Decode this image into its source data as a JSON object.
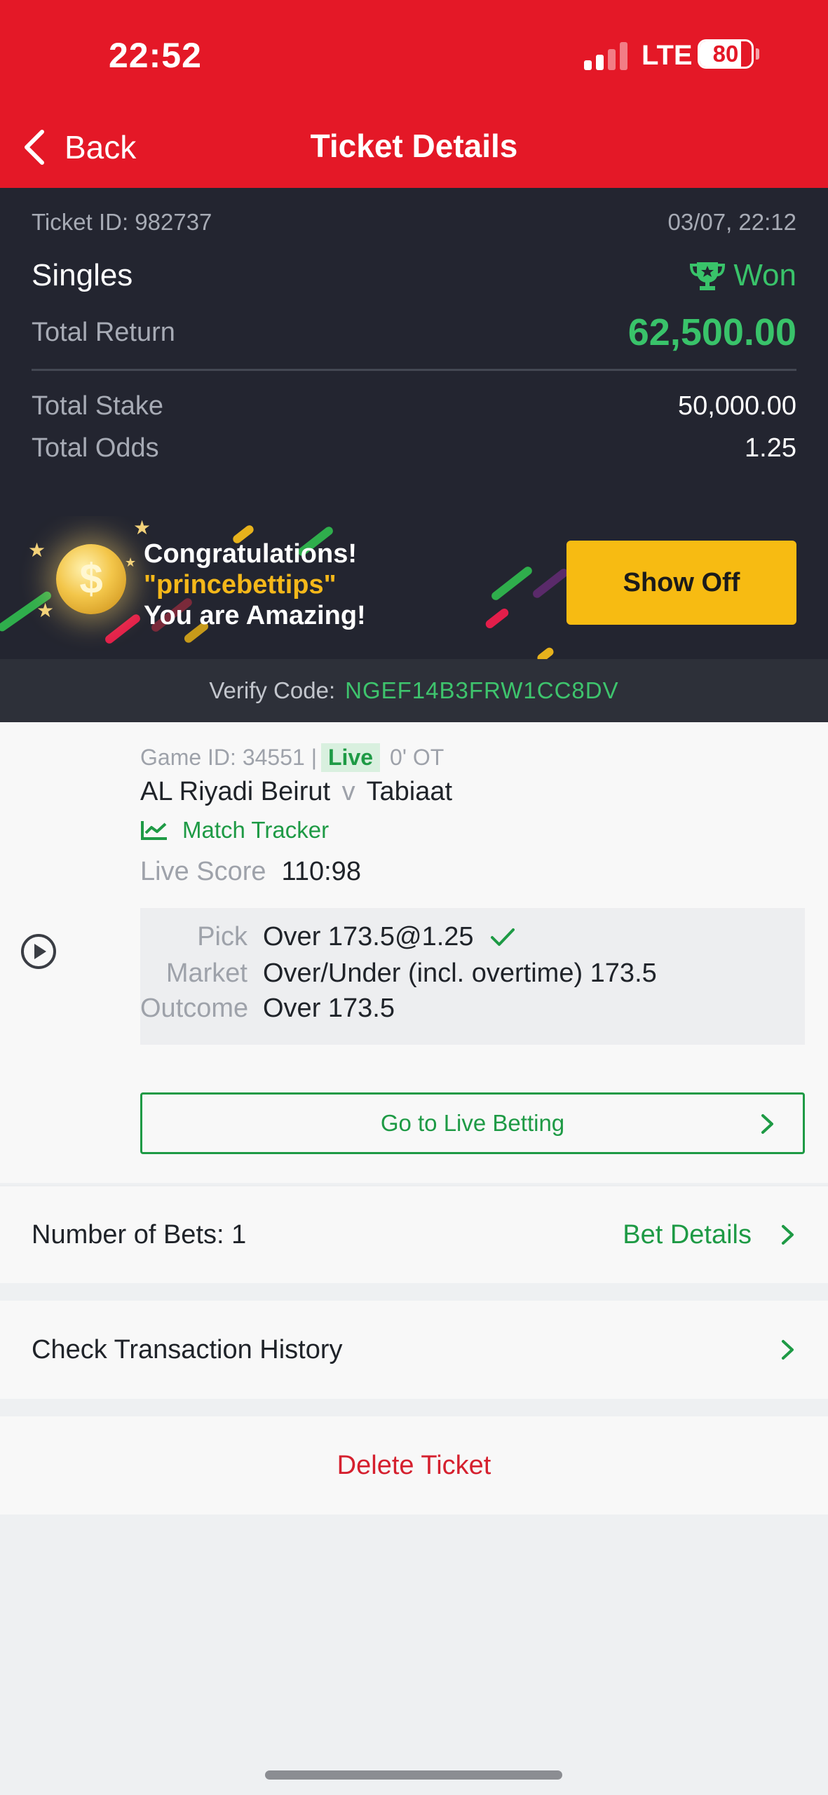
{
  "status_bar": {
    "time": "22:52",
    "network": "LTE",
    "battery_percent": "80",
    "battery_level": 0.8
  },
  "header": {
    "back_label": "Back",
    "title": "Ticket Details"
  },
  "summary": {
    "ticket_id": "Ticket ID: 982737",
    "datetime": "03/07, 22:12",
    "bet_type": "Singles",
    "status": "Won",
    "total_return_label": "Total Return",
    "total_return": "62,500.00",
    "total_stake_label": "Total Stake",
    "total_stake": "50,000.00",
    "total_odds_label": "Total Odds",
    "total_odds": "1.25"
  },
  "banner": {
    "line1": "Congratulations!",
    "line2": "\"princebettips\"",
    "line3": "You are Amazing!",
    "coin_symbol": "$",
    "show_off_label": "Show Off"
  },
  "verify": {
    "label": "Verify Code:",
    "code": "NGEF14B3FRW1CC8DV"
  },
  "bet": {
    "game_id": "Game ID: 34551 |",
    "live_badge": "Live",
    "clock": "0' OT",
    "home_team": "AL Riyadi Beirut",
    "vs": "v",
    "away_team": "Tabiaat",
    "tracker_label": "Match Tracker",
    "live_score_label": "Live Score",
    "live_score": "110:98",
    "pick_label": "Pick",
    "pick": "Over 173.5@1.25",
    "market_label": "Market",
    "market": "Over/Under (incl. overtime) 173.5",
    "outcome_label": "Outcome",
    "outcome": "Over 173.5",
    "live_betting_label": "Go to Live Betting"
  },
  "rows": {
    "number_of_bets": "Number of Bets: 1",
    "bet_details": "Bet Details",
    "transaction_history": "Check Transaction History",
    "delete_ticket": "Delete Ticket"
  },
  "colors": {
    "header_red": "#e41827",
    "win_green": "#39c36a",
    "accent_green": "#1e9a45",
    "show_off_yellow": "#f7bb12",
    "delete_red": "#d5202e"
  },
  "icons": [
    "back-chevron-icon",
    "trophy-icon",
    "coin-icon",
    "star-icon",
    "chart-line-icon",
    "play-circle-icon",
    "checkmark-icon",
    "chevron-right-icon"
  ]
}
